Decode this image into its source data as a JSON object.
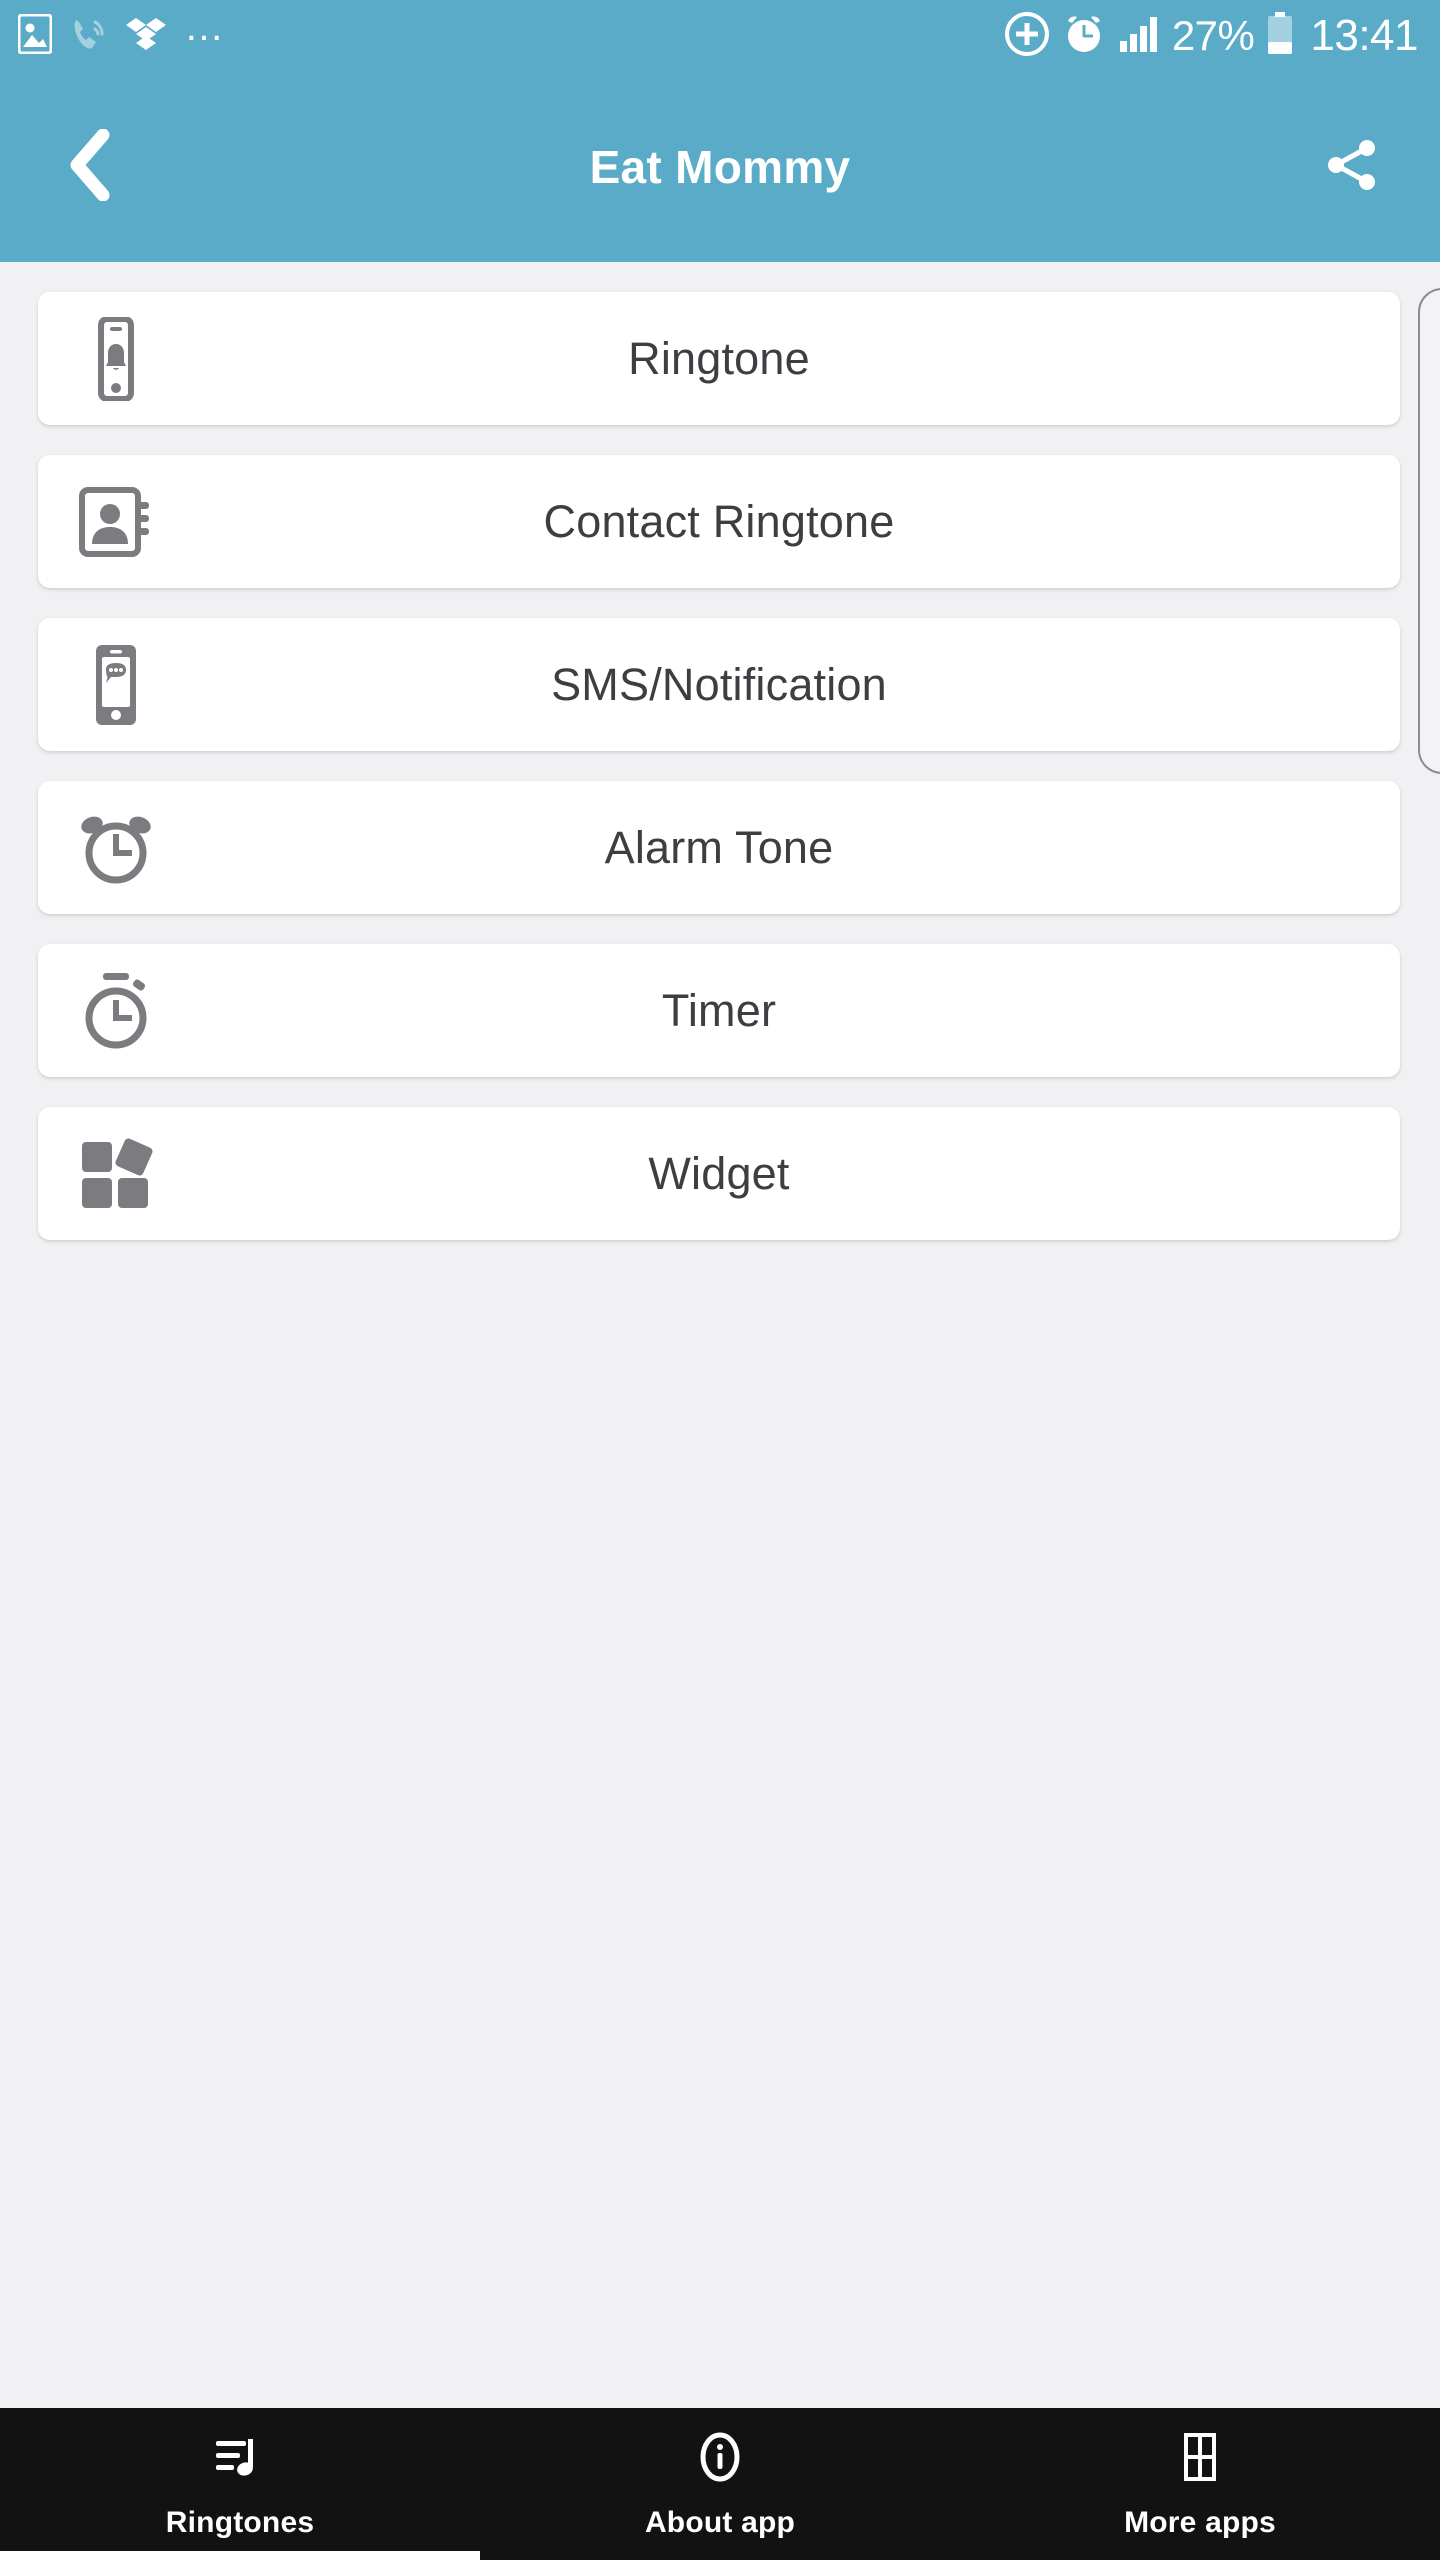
{
  "status_bar": {
    "left_icons": [
      {
        "name": "image-icon",
        "label": "screenshot"
      },
      {
        "name": "call-icon",
        "label": "phone call"
      },
      {
        "name": "dropbox-icon",
        "label": "dropbox"
      },
      {
        "name": "more-notifications-icon",
        "label": "..."
      }
    ],
    "right_icons": [
      {
        "name": "data-saver-icon",
        "label": "add circle"
      },
      {
        "name": "alarm-icon",
        "label": "alarm set"
      },
      {
        "name": "signal-icon",
        "label": "signal strength"
      },
      {
        "name": "battery-icon",
        "label": "battery"
      }
    ],
    "battery_percent": "27%",
    "clock": "13:41",
    "background_color": "#59abc7",
    "foreground_color": "#ffffff"
  },
  "app_bar": {
    "title": "Eat Mommy",
    "back_icon": "chevron-left-icon",
    "share_icon": "share-icon",
    "background_color": "#59abc7"
  },
  "main": {
    "background_color": "#f1f1f3",
    "cards": [
      {
        "label": "Ringtone",
        "icon": "phone-bell-icon"
      },
      {
        "label": "Contact Ringtone",
        "icon": "contact-book-icon"
      },
      {
        "label": "SMS/Notification",
        "icon": "phone-message-icon"
      },
      {
        "label": "Alarm Tone",
        "icon": "alarm-clock-icon"
      },
      {
        "label": "Timer",
        "icon": "stopwatch-icon"
      },
      {
        "label": "Widget",
        "icon": "widget-grid-icon"
      }
    ]
  },
  "bottom_nav": {
    "background_color": "#121212",
    "active_index": 0,
    "items": [
      {
        "label": "Ringtones",
        "icon": "playlist-music-icon",
        "active": true
      },
      {
        "label": "About app",
        "icon": "info-circle-icon",
        "active": false
      },
      {
        "label": "More apps",
        "icon": "grid-apps-icon",
        "active": false
      }
    ]
  }
}
